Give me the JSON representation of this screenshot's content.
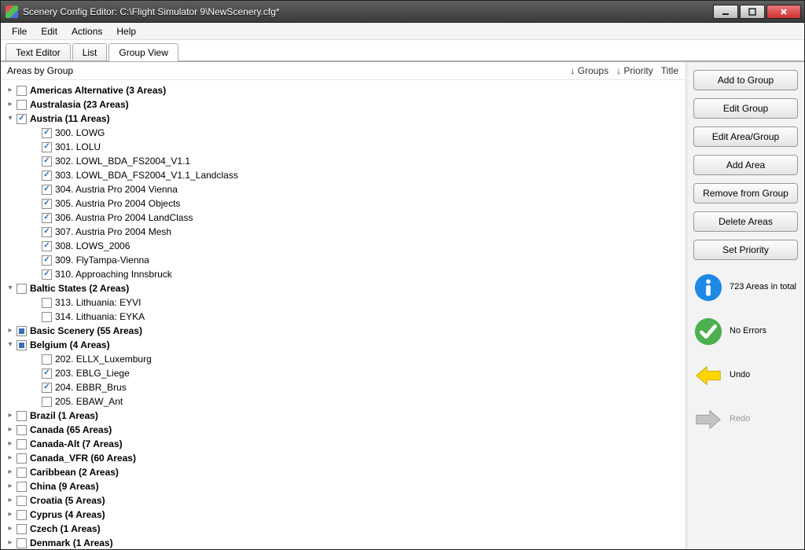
{
  "window": {
    "title": "Scenery Config Editor: C:\\Flight Simulator 9\\NewScenery.cfg*"
  },
  "menubar": [
    "File",
    "Edit",
    "Actions",
    "Help"
  ],
  "tabs": {
    "items": [
      "Text Editor",
      "List",
      "Group View"
    ],
    "active_index": 2
  },
  "tree_header": {
    "label": "Areas by Group",
    "col_groups": "↓ Groups",
    "col_priority": "↓ Priority",
    "col_title": "Title"
  },
  "tree": [
    {
      "label": "Americas Alternative (3 Areas)",
      "expanded": false,
      "check": "none",
      "children": []
    },
    {
      "label": "Australasia (23 Areas)",
      "expanded": false,
      "check": "none",
      "children": []
    },
    {
      "label": "Austria (11 Areas)",
      "expanded": true,
      "check": "checked",
      "children": [
        {
          "label": "300. LOWG",
          "check": "checked"
        },
        {
          "label": "301. LOLU",
          "check": "checked"
        },
        {
          "label": "302. LOWL_BDA_FS2004_V1.1",
          "check": "checked"
        },
        {
          "label": "303. LOWL_BDA_FS2004_V1.1_Landclass",
          "check": "checked"
        },
        {
          "label": "304. Austria Pro 2004 Vienna",
          "check": "checked"
        },
        {
          "label": "305. Austria Pro 2004 Objects",
          "check": "checked"
        },
        {
          "label": "306. Austria Pro 2004 LandClass",
          "check": "checked"
        },
        {
          "label": "307. Austria Pro 2004 Mesh",
          "check": "checked"
        },
        {
          "label": "308. LOWS_2006",
          "check": "checked"
        },
        {
          "label": "309. FlyTampa-Vienna",
          "check": "checked"
        },
        {
          "label": "310. Approaching Innsbruck",
          "check": "checked"
        }
      ]
    },
    {
      "label": "Baltic States (2 Areas)",
      "expanded": true,
      "check": "none",
      "children": [
        {
          "label": "313. Lithuania: EYVI",
          "check": "none"
        },
        {
          "label": "314. Lithuania: EYKA",
          "check": "none"
        }
      ]
    },
    {
      "label": "Basic Scenery (55 Areas)",
      "expanded": false,
      "check": "indet",
      "children": []
    },
    {
      "label": "Belgium (4 Areas)",
      "expanded": true,
      "check": "indet",
      "children": [
        {
          "label": "202. ELLX_Luxemburg",
          "check": "none"
        },
        {
          "label": "203. EBLG_Liege",
          "check": "checked"
        },
        {
          "label": "204. EBBR_Brus",
          "check": "checked"
        },
        {
          "label": "205. EBAW_Ant",
          "check": "none"
        }
      ]
    },
    {
      "label": "Brazil (1 Areas)",
      "expanded": false,
      "check": "none",
      "children": []
    },
    {
      "label": "Canada (65 Areas)",
      "expanded": false,
      "check": "none",
      "children": []
    },
    {
      "label": "Canada-Alt (7 Areas)",
      "expanded": false,
      "check": "none",
      "children": []
    },
    {
      "label": "Canada_VFR (60 Areas)",
      "expanded": false,
      "check": "none",
      "children": []
    },
    {
      "label": "Caribbean (2 Areas)",
      "expanded": false,
      "check": "none",
      "children": []
    },
    {
      "label": "China (9 Areas)",
      "expanded": false,
      "check": "none",
      "children": []
    },
    {
      "label": "Croatia (5 Areas)",
      "expanded": false,
      "check": "none",
      "children": []
    },
    {
      "label": "Cyprus (4 Areas)",
      "expanded": false,
      "check": "none",
      "children": []
    },
    {
      "label": "Czech (1 Areas)",
      "expanded": false,
      "check": "none",
      "children": []
    },
    {
      "label": "Denmark (1 Areas)",
      "expanded": false,
      "check": "none",
      "children": []
    }
  ],
  "side_buttons": [
    "Add to Group",
    "Edit Group",
    "Edit Area/Group",
    "Add Area",
    "Remove from Group",
    "Delete Areas",
    "Set Priority"
  ],
  "status": {
    "info": "723 Areas in total",
    "ok": "No Errors",
    "undo": "Undo",
    "redo": "Redo"
  }
}
